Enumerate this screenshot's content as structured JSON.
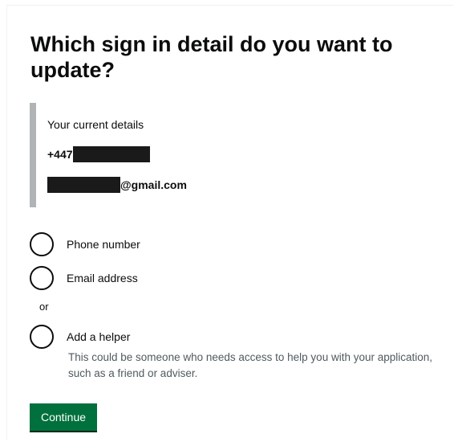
{
  "page": {
    "title": "Which sign in detail do you want to update?"
  },
  "current_details": {
    "heading": "Your current details",
    "phone_prefix": "+447",
    "email_suffix": "@gmail.com"
  },
  "options": {
    "phone_label": "Phone number",
    "email_label": "Email address",
    "divider": "or",
    "helper_label": "Add a helper",
    "helper_hint": "This could be someone who needs access to help you with your application, such as a friend or adviser."
  },
  "actions": {
    "continue_label": "Continue"
  },
  "colors": {
    "button_green": "#00703c",
    "inset_border": "#b1b4b6",
    "text": "#0b0c0c",
    "hint_text": "#505a5f",
    "redaction": "#1a1a1a"
  }
}
